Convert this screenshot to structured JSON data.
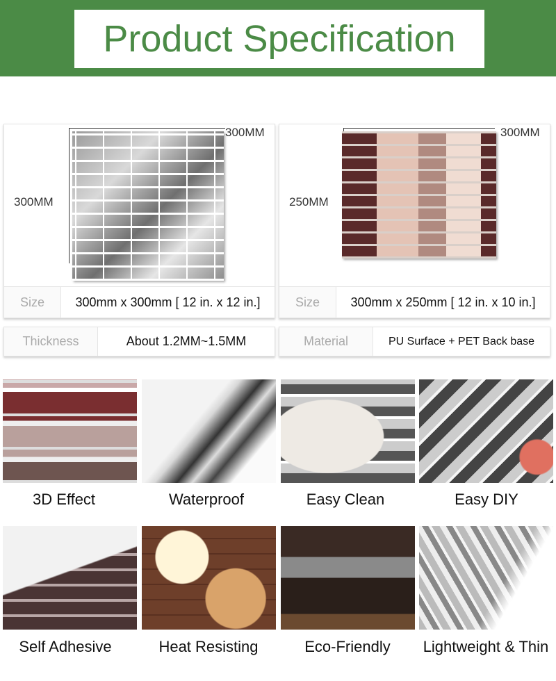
{
  "header": {
    "title": "Product Specification"
  },
  "products": [
    {
      "width_label": "300MM",
      "height_label": "300MM",
      "size_label": "Size",
      "size_value": "300mm x 300mm [ 12 in. x 12 in.]"
    },
    {
      "width_label": "300MM",
      "height_label": "250MM",
      "size_label": "Size",
      "size_value": "300mm x 250mm [ 12 in. x 10 in.]"
    }
  ],
  "specs": [
    {
      "label": "Thickness",
      "value": "About 1.2MM~1.5MM"
    },
    {
      "label": "Material",
      "value": "PU Surface + PET Back base"
    }
  ],
  "features": [
    {
      "label": "3D Effect"
    },
    {
      "label": "Waterproof"
    },
    {
      "label": "Easy Clean"
    },
    {
      "label": "Easy DIY"
    },
    {
      "label": "Self Adhesive"
    },
    {
      "label": "Heat Resisting"
    },
    {
      "label": "Eco-Friendly"
    },
    {
      "label": "Lightweight & Thin"
    }
  ],
  "colors": {
    "brand_green": "#4b8b46"
  }
}
